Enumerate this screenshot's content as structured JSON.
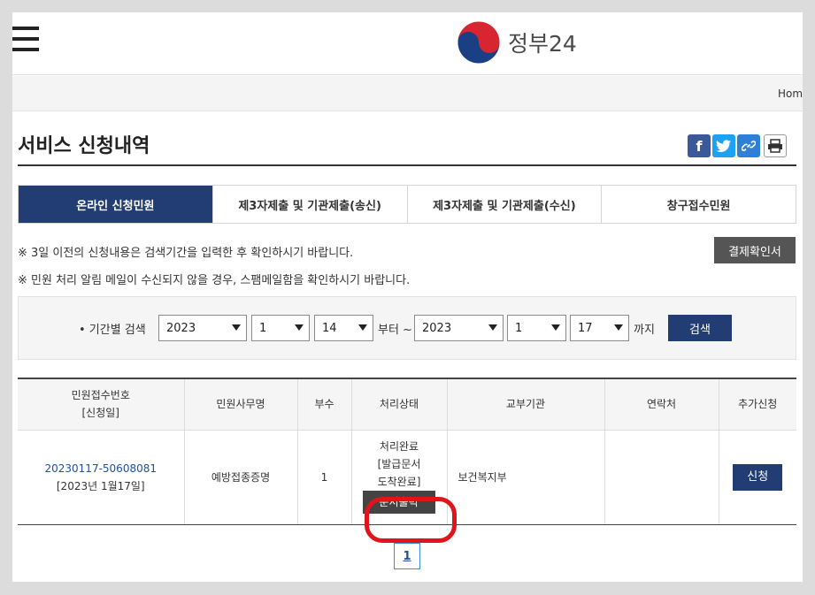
{
  "header": {
    "logo_text": "정부24",
    "breadcrumb": "Home"
  },
  "page": {
    "title": "서비스 신청내역"
  },
  "share_icons": [
    "facebook-icon",
    "twitter-icon",
    "link-icon",
    "print-icon"
  ],
  "tabs": [
    {
      "label": "온라인 신청민원",
      "active": true
    },
    {
      "label": "제3자제출 및 기관제출(송신)",
      "active": false
    },
    {
      "label": "제3자제출 및 기관제출(수신)",
      "active": false
    },
    {
      "label": "창구접수민원",
      "active": false
    }
  ],
  "notices": [
    "※ 3일 이전의 신청내용은 검색기간을 입력한 후 확인하시기 바랍니다.",
    "※ 민원 처리 알림 메일이 수신되지 않을 경우, 스팸메일함을 확인하시기 바랍니다."
  ],
  "payment_button": "결제확인서",
  "search": {
    "label": "• 기간별 검색",
    "from_year": "2023",
    "from_month": "1",
    "from_day": "14",
    "from_text": "부터 ~",
    "to_year": "2023",
    "to_month": "1",
    "to_day": "17",
    "to_text": "까지",
    "button": "검색"
  },
  "table": {
    "headers": [
      "민원접수번호",
      "[신청일]",
      "민원사무명",
      "부수",
      "처리상태",
      "교부기관",
      "연락처",
      "추가신청"
    ],
    "row": {
      "receipt_no": "20230117-50608081",
      "date": "[2023년 1월17일]",
      "service": "예방접종증명",
      "copies": "1",
      "status_1": "처리완료",
      "status_2": "[발급문서",
      "status_3": "도착완료]",
      "print_button": "문서출력",
      "agency": "보건복지부",
      "contact": "",
      "apply_button": "신청"
    }
  },
  "pagination": {
    "current": "1"
  },
  "colors": {
    "navy": "#213d74",
    "highlight": "#e0151b",
    "facebook": "#3b5998",
    "twitter": "#1da1f2",
    "link": "#2f7fd6"
  }
}
